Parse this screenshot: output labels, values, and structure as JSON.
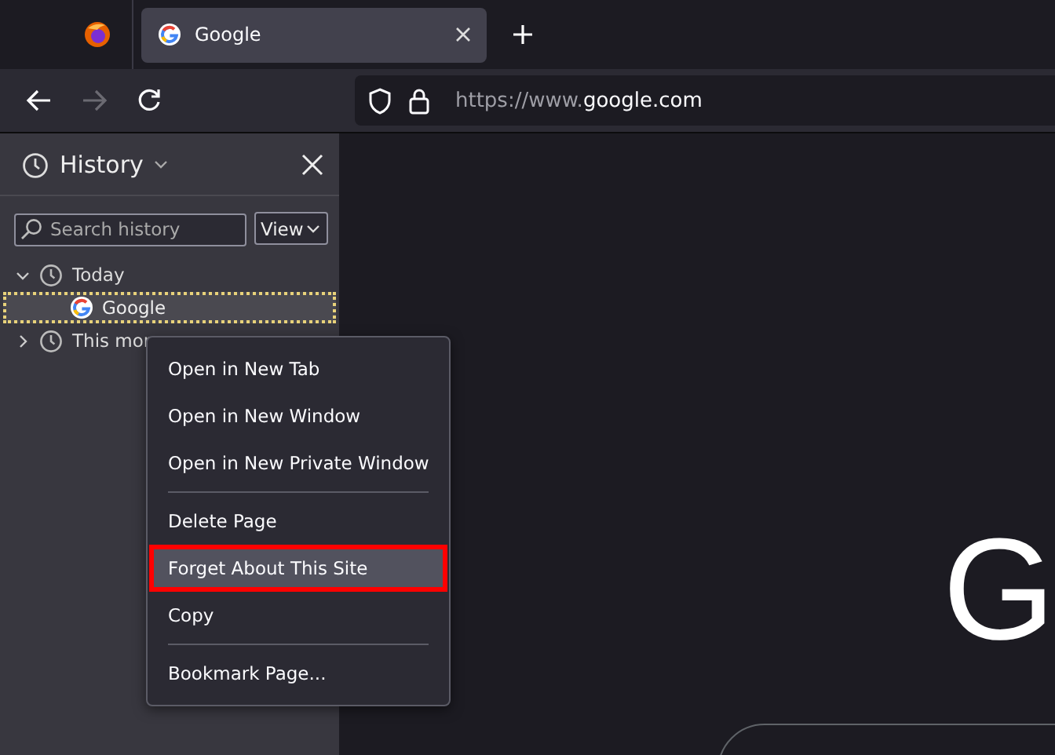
{
  "tabs": [
    {
      "title": "Google",
      "selected": true
    }
  ],
  "nav": {
    "back_disabled": false,
    "forward_disabled": true,
    "url_prefix": "https://www.",
    "url_domain": "google.com"
  },
  "sidebar": {
    "title": "History",
    "search": {
      "placeholder": "Search history"
    },
    "view_button": "View",
    "tree": [
      {
        "label": "Today",
        "expanded": true,
        "children": [
          {
            "label": "Google",
            "selected": true
          }
        ]
      },
      {
        "label": "This mor",
        "expanded": false
      }
    ]
  },
  "context_menu": {
    "groups": [
      [
        {
          "label": "Open in New Tab",
          "selected": false,
          "outlined": false
        },
        {
          "label": "Open in New Window",
          "selected": false,
          "outlined": false
        },
        {
          "label": "Open in New Private Window",
          "selected": false,
          "outlined": false
        }
      ],
      [
        {
          "label": "Delete Page",
          "selected": false,
          "outlined": false
        },
        {
          "label": "Forget About This Site",
          "selected": true,
          "outlined": true
        },
        {
          "label": "Copy",
          "selected": false,
          "outlined": false
        }
      ],
      [
        {
          "label": "Bookmark Page...",
          "selected": false,
          "outlined": false
        }
      ]
    ]
  },
  "page": {
    "logo_text": "G"
  }
}
